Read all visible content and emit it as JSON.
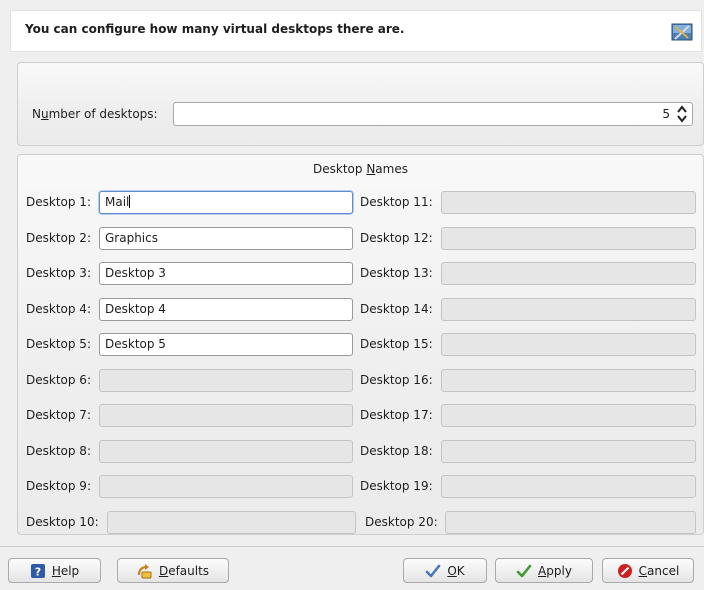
{
  "header": {
    "text": "You can configure how many virtual desktops there are.",
    "icon": "desktop-tools-icon"
  },
  "count": {
    "label_pre": "N",
    "label_underlined": "u",
    "label_post": "mber of desktops:",
    "value": "5"
  },
  "names": {
    "title_pre": "Desktop ",
    "title_underlined": "N",
    "title_post": "ames",
    "labels_left": [
      "Desktop 1:",
      "Desktop 2:",
      "Desktop 3:",
      "Desktop 4:",
      "Desktop 5:",
      "Desktop 6:",
      "Desktop 7:",
      "Desktop 8:",
      "Desktop 9:",
      "Desktop 10:"
    ],
    "values_left": [
      "Mail",
      "Graphics",
      "Desktop 3",
      "Desktop 4",
      "Desktop 5",
      "",
      "",
      "",
      "",
      ""
    ],
    "labels_right": [
      "Desktop 11:",
      "Desktop 12:",
      "Desktop 13:",
      "Desktop 14:",
      "Desktop 15:",
      "Desktop 16:",
      "Desktop 17:",
      "Desktop 18:",
      "Desktop 19:",
      "Desktop 20:"
    ],
    "values_right": [
      "",
      "",
      "",
      "",
      "",
      "",
      "",
      "",
      "",
      ""
    ],
    "enabled_count": 5
  },
  "buttons": {
    "help": {
      "underlined": "H",
      "rest": "elp",
      "icon": "help-icon"
    },
    "defaults": {
      "underlined": "D",
      "rest": "efaults",
      "icon": "defaults-icon"
    },
    "ok": {
      "underlined": "O",
      "rest": "K",
      "icon": "checkmark-icon"
    },
    "apply": {
      "underlined": "A",
      "rest": "pply",
      "icon": "checkmark-icon"
    },
    "cancel": {
      "underlined": "C",
      "rest": "ancel",
      "icon": "cancel-icon"
    }
  },
  "colors": {
    "accent": "#5f8ccc",
    "help_icon": "#2f5aa8",
    "ok_check": "#4a76b8",
    "apply_check": "#3f9a2f",
    "cancel_red": "#cc1f1f"
  }
}
